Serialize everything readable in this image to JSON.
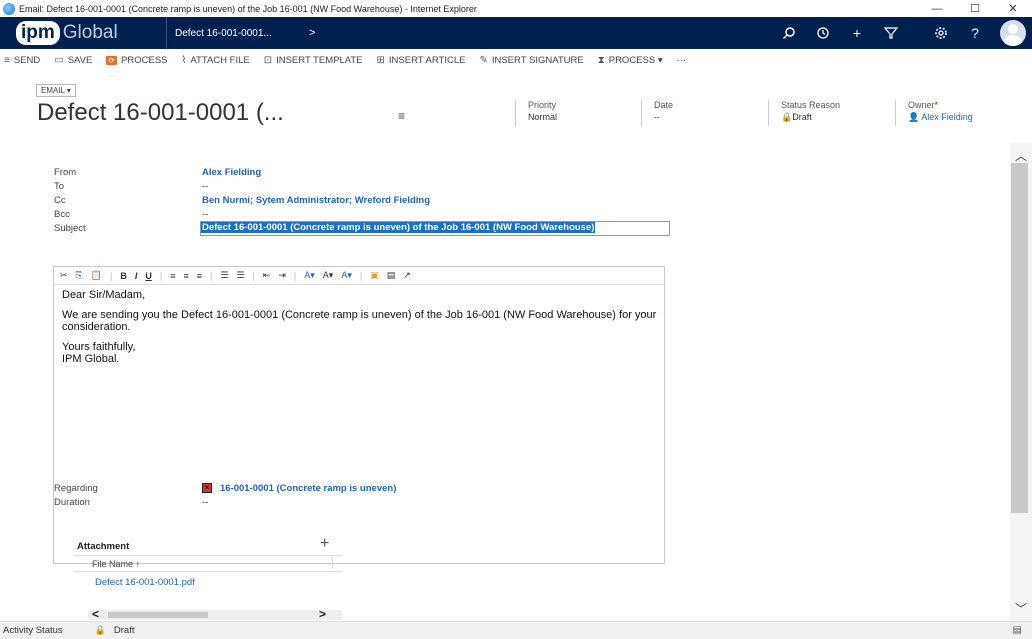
{
  "window": {
    "title": "Email: Defect 16-001-0001 (Concrete ramp is uneven) of the Job 16-001 (NW Food Warehouse) - Internet Explorer",
    "minimize": "—",
    "maximize": "☐",
    "close": "✕"
  },
  "nav": {
    "logo_main": "ipm",
    "logo_sub": "Global",
    "record": "Defect 16-001-0001...",
    "chevron": ">",
    "icons": [
      "search-icon",
      "history-icon",
      "plus-icon",
      "filter-icon",
      "gear-icon",
      "help-icon",
      "avatar"
    ],
    "help": "?",
    "plus": "+"
  },
  "commands": [
    {
      "icon": "≡",
      "label": "SEND"
    },
    {
      "icon": "▭",
      "label": "SAVE"
    },
    {
      "icon": "⟳",
      "label": "PROCESS"
    },
    {
      "icon": "⌇",
      "label": "ATTACH FILE"
    },
    {
      "icon": "⊡",
      "label": "INSERT TEMPLATE"
    },
    {
      "icon": "⊞",
      "label": "INSERT ARTICLE"
    },
    {
      "icon": "✎",
      "label": "INSERT SIGNATURE"
    },
    {
      "icon": "⧗",
      "label": "PROCESS ▾"
    }
  ],
  "more": "···",
  "header": {
    "entity": "EMAIL ▾",
    "title": "Defect 16-001-0001 (...",
    "title_menu": "≡",
    "priority": {
      "label": "Priority",
      "value": "Normal"
    },
    "date": {
      "label": "Date",
      "value": "--"
    },
    "status_reason": {
      "label": "Status Reason",
      "value": "Draft"
    },
    "owner": {
      "label": "Owner",
      "required": "*",
      "value": "Alex Fielding"
    }
  },
  "form": {
    "from": {
      "label": "From",
      "value": "Alex Fielding"
    },
    "to": {
      "label": "To",
      "value": "--"
    },
    "cc": {
      "label": "Cc",
      "value": "Ben Nurmi; Sytem Administrator; Wreford Fielding"
    },
    "bcc": {
      "label": "Bcc",
      "value": "--"
    },
    "subject": {
      "label": "Subject",
      "value": "Defect 16-001-0001 (Concrete ramp is uneven) of the Job 16-001 (NW Food Warehouse)"
    },
    "regarding": {
      "label": "Regarding",
      "value": "16-001-0001 (Concrete ramp is uneven)"
    },
    "duration": {
      "label": "Duration",
      "value": "--"
    }
  },
  "editor": {
    "toolbar": [
      "✂",
      "⎘",
      "📋",
      "B",
      "I",
      "U",
      "≡",
      "≡",
      "≡",
      "☰",
      "☰",
      "⇤",
      "⇥",
      "A▾",
      "A▾",
      "A▾",
      "▣",
      "▤",
      "↗"
    ],
    "body": [
      "Dear Sir/Madam,",
      "We are sending you the Defect 16-001-0001 (Concrete ramp is uneven) of the Job 16-001 (NW Food Warehouse) for your consideration.",
      "Yours faithfully,\nIPM Global."
    ]
  },
  "attachment": {
    "title": "Attachment",
    "add": "+",
    "column": "File Name ↑",
    "files": [
      "Defect 16-001-0001.pdf"
    ]
  },
  "status": {
    "label": "Activity Status",
    "value": "Draft"
  }
}
